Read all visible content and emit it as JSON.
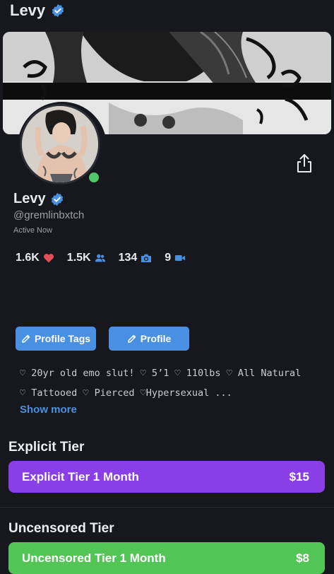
{
  "header": {
    "title": "Levy"
  },
  "profile": {
    "name": "Levy",
    "handle": "@gremlinbxtch",
    "status": "Active Now"
  },
  "stats": [
    {
      "value": "1.6K",
      "icon": "heart-icon",
      "color": "#e0505a"
    },
    {
      "value": "1.5K",
      "icon": "users-icon",
      "color": "#4a90e2"
    },
    {
      "value": "134",
      "icon": "camera-icon",
      "color": "#4a90e2"
    },
    {
      "value": "9",
      "icon": "video-icon",
      "color": "#4a90e2"
    }
  ],
  "buttons": {
    "profile_tags": "Profile Tags",
    "profile": "Profile"
  },
  "bio": {
    "line1": "♡ 20yr old emo slut! ♡ 5’1 ♡ 110lbs ♡ All Natural",
    "line2": "♡ Tattooed ♡ Pierced ♡Hypersexual ...",
    "show_more": "Show more"
  },
  "tiers": [
    {
      "heading": "Explicit Tier",
      "label": "Explicit Tier 1 Month",
      "price": "$15",
      "color": "#8a3fe6"
    },
    {
      "heading": "Uncensored Tier",
      "label": "Uncensored Tier 1 Month",
      "price": "$8",
      "color": "#53c557"
    }
  ],
  "colors": {
    "accent": "#4a90e2",
    "background": "#16181d",
    "online": "#51c867"
  }
}
